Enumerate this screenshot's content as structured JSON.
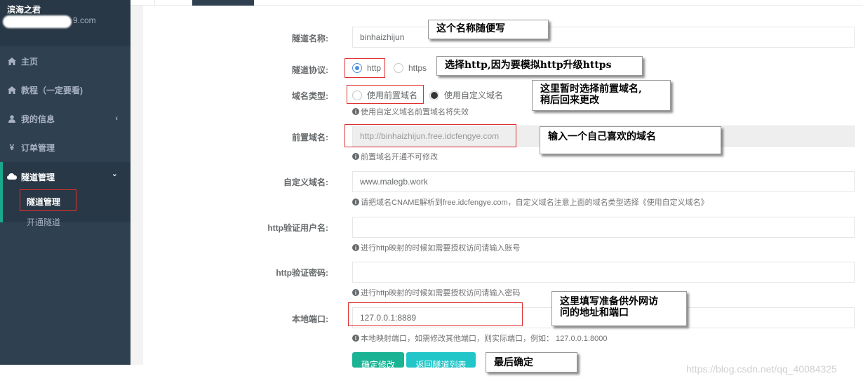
{
  "user": {
    "name": "滨海之君",
    "email_domain": "9.com"
  },
  "sidebar": {
    "items": [
      {
        "label": "主页",
        "icon": "home-icon"
      },
      {
        "label": "教程（一定要看)",
        "icon": "home-icon"
      },
      {
        "label": "我的信息",
        "icon": "user-icon",
        "arrow": "‹"
      },
      {
        "label": "订单管理",
        "icon": "yen-icon"
      },
      {
        "label": "隧道管理",
        "icon": "cloud-icon",
        "arrow": "⌄"
      }
    ],
    "subitems": [
      {
        "label": "隧道管理"
      },
      {
        "label": "开通隧道"
      }
    ]
  },
  "form": {
    "tunnel_name": {
      "label": "隧道名称:",
      "value": "binhaizhijun"
    },
    "protocol": {
      "label": "隧道协议:",
      "options": [
        "http",
        "https"
      ],
      "selected": "http"
    },
    "domain_type": {
      "label": "域名类型:",
      "options": [
        "使用前置域名",
        "使用自定义域名"
      ],
      "selected": "使用自定义域名",
      "help": "使用自定义域名前置域名将失效"
    },
    "prefix_domain": {
      "label": "前置域名:",
      "value": "http://binhaizhijun.free.idcfengye.com",
      "help": "前置域名开通不可修改"
    },
    "custom_domain": {
      "label": "自定义域名:",
      "value": "www.malegb.work",
      "help": "请把域名CNAME解析到free.idcfengye.com，自定义域名注意上面的域名类型选择《使用自定义域名》"
    },
    "http_user": {
      "label": "http验证用户名:",
      "value": "",
      "help": "进行http映射的时候如需要授权访问请输入账号"
    },
    "http_pass": {
      "label": "http验证密码:",
      "value": "",
      "help": "进行http映射的时候如需要授权访问请输入密码"
    },
    "local_port": {
      "label": "本地端口:",
      "value": "127.0.0.1:8889",
      "help": "本地映射端口，如需修改其他端口，则实际端口，例如：  127.0.0.1:8000"
    }
  },
  "buttons": {
    "confirm": "确定修改",
    "back": "返回隧道列表"
  },
  "callouts": {
    "name": "这个名称随便写",
    "protocol": "选择http,因为要模拟http升级https",
    "domain_type_line1": "这里暂时选择前置域名,",
    "domain_type_line2": "稍后回来更改",
    "prefix": "输入一个自己喜欢的域名",
    "port_line1": "这里填写准备供外网访",
    "port_line2": "问的地址和端口",
    "final": "最后确定"
  },
  "watermark": "https://blog.csdn.net/qq_40084325",
  "colors": {
    "sidebar": "#2f4050",
    "accent": "#1ab394",
    "info": "#23c6c8",
    "highlight": "#e03030"
  }
}
